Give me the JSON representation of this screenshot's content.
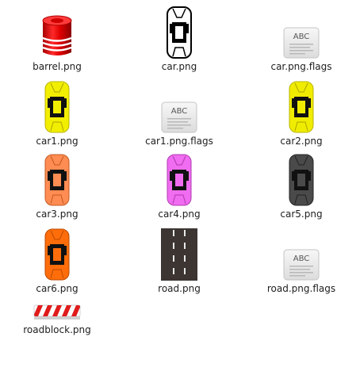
{
  "files": [
    {
      "name": "barrel.png",
      "icon": "barrel-icon"
    },
    {
      "name": "car.png",
      "icon": "car-outline-icon",
      "color": "#ffffff"
    },
    {
      "name": "car.png.flags",
      "icon": "text-document-icon",
      "icon_text": "ABC"
    },
    {
      "name": "car1.png",
      "icon": "car-icon",
      "color": "#f2ee00"
    },
    {
      "name": "car1.png.flags",
      "icon": "text-document-icon",
      "icon_text": "ABC"
    },
    {
      "name": "car2.png",
      "icon": "car-icon",
      "color": "#f0ec00"
    },
    {
      "name": "car3.png",
      "icon": "car-icon",
      "color": "#ff8c52"
    },
    {
      "name": "car4.png",
      "icon": "car-icon",
      "color": "#f06cf0"
    },
    {
      "name": "car5.png",
      "icon": "car-icon",
      "color": "#4a4a4a"
    },
    {
      "name": "car6.png",
      "icon": "car-icon",
      "color": "#ff6d0a"
    },
    {
      "name": "road.png",
      "icon": "road-icon"
    },
    {
      "name": "road.png.flags",
      "icon": "text-document-icon",
      "icon_text": "ABC"
    },
    {
      "name": "roadblock.png",
      "icon": "roadblock-icon"
    }
  ]
}
